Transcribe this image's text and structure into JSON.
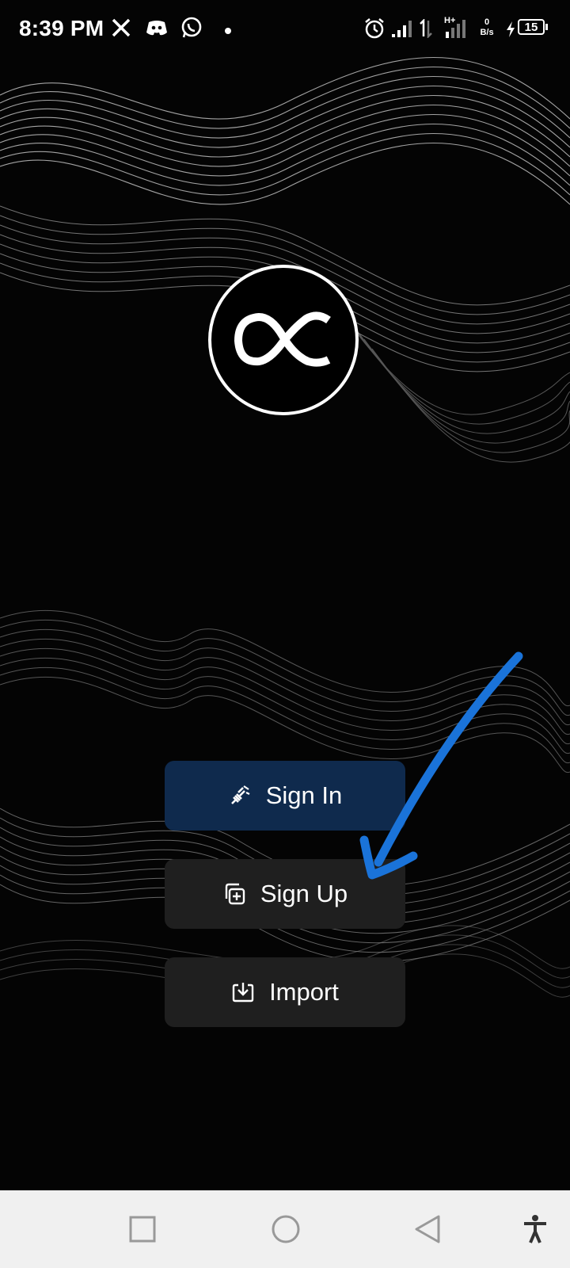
{
  "status_bar": {
    "time": "8:39 PM",
    "net_speed_value": "0",
    "net_speed_unit": "B/s",
    "network_type": "H+",
    "battery_level": "15",
    "notification_icons": [
      "x-icon",
      "discord-icon",
      "whatsapp-icon",
      "dot-icon"
    ],
    "system_icons": [
      "alarm-icon",
      "signal-icon",
      "data-arrows-icon",
      "signal-h-plus-icon",
      "charging-icon",
      "battery-icon"
    ]
  },
  "logo": {
    "icon": "alpha-logo-icon"
  },
  "buttons": {
    "sign_in": {
      "label": "Sign In",
      "icon": "plug-icon",
      "color": "#0f2a4d"
    },
    "sign_up": {
      "label": "Sign Up",
      "icon": "add-copy-icon",
      "color": "#1f1f1f"
    },
    "import": {
      "label": "Import",
      "icon": "download-tray-icon",
      "color": "#1f1f1f"
    }
  },
  "annotation": {
    "icon": "arrow-annotation",
    "color": "#1a73d9"
  },
  "nav_bar": {
    "buttons": [
      "recents-square-icon",
      "home-circle-icon",
      "back-triangle-icon",
      "accessibility-icon"
    ]
  }
}
